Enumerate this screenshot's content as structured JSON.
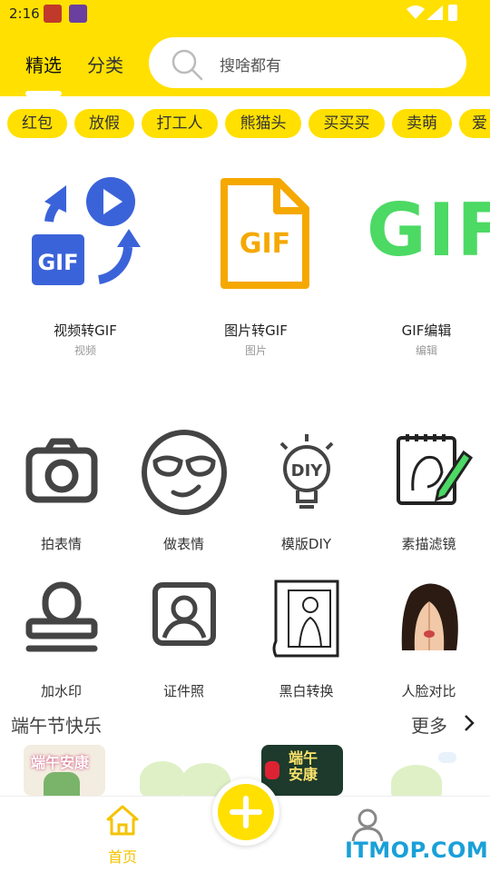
{
  "status_bar": {
    "time": "2:16"
  },
  "header": {
    "tabs": [
      {
        "label": "精选",
        "active": true
      },
      {
        "label": "分类",
        "active": false
      }
    ],
    "search": {
      "placeholder": "搜啥都有"
    }
  },
  "chips": [
    "红包",
    "放假",
    "打工人",
    "熊猫头",
    "买买买",
    "卖萌",
    "爱"
  ],
  "features": [
    {
      "title": "视频转GIF",
      "subtitle": "视频",
      "icon": "video-to-gif-icon"
    },
    {
      "title": "图片转GIF",
      "subtitle": "图片",
      "icon": "image-to-gif-icon"
    },
    {
      "title": "GIF编辑",
      "subtitle": "编辑",
      "icon": "gif-edit-icon",
      "icon_text": "GIF"
    }
  ],
  "gif_badge": "GIF",
  "tools": [
    {
      "label": "拍表情",
      "icon": "camera-icon"
    },
    {
      "label": "做表情",
      "icon": "sunglasses-face-icon"
    },
    {
      "label": "模版DIY",
      "icon": "diy-bulb-icon",
      "icon_text": "DIY"
    },
    {
      "label": "素描滤镜",
      "icon": "sketch-pencil-icon"
    },
    {
      "label": "加水印",
      "icon": "stamp-icon"
    },
    {
      "label": "证件照",
      "icon": "id-photo-icon"
    },
    {
      "label": "黑白转换",
      "icon": "bw-convert-icon"
    },
    {
      "label": "人脸对比",
      "icon": "face-compare-icon"
    }
  ],
  "section": {
    "title": "端午节快乐",
    "more": "更多"
  },
  "thumbnails": [
    {
      "caption": "端午安康"
    },
    {
      "caption": ""
    },
    {
      "caption": "端午安康"
    },
    {
      "caption": ""
    }
  ],
  "bottom_nav": {
    "home_label": "首页",
    "watermark": "ITMOP.COM"
  },
  "colors": {
    "accent": "#ffe000",
    "home_active": "#f4c300",
    "blue": "#3b63d9",
    "orange": "#f5a800",
    "green": "#4cd964"
  }
}
